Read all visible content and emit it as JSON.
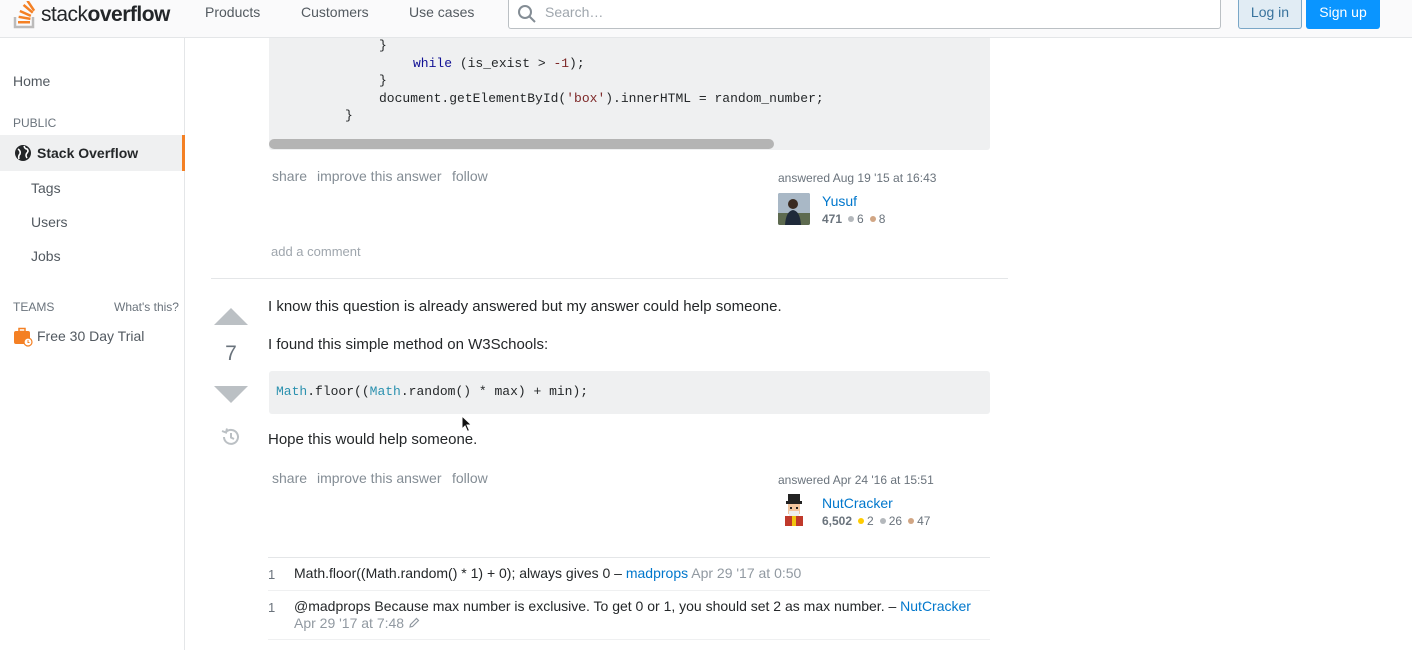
{
  "header": {
    "logo_prefix": "stack",
    "logo_suffix": "overflow",
    "nav": [
      "Products",
      "Customers",
      "Use cases"
    ],
    "search_placeholder": "Search…",
    "login_label": "Log in",
    "signup_label": "Sign up"
  },
  "sidebar": {
    "home": "Home",
    "public_label": "PUBLIC",
    "active_label": "Stack Overflow",
    "items": [
      "Tags",
      "Users",
      "Jobs"
    ],
    "teams_label": "TEAMS",
    "whats_this": "What's this?",
    "trial": "Free 30 Day Trial"
  },
  "answer1": {
    "code_lines": [
      {
        "indent": 4,
        "parts": [
          [
            "}",
            ""
          ]
        ]
      },
      {
        "indent": 4,
        "parts": [
          [
            "while",
            "kw"
          ],
          [
            " (is_exist > ",
            ""
          ],
          [
            "-1",
            "num"
          ],
          [
            ");",
            ""
          ]
        ]
      },
      {
        "indent": 3,
        "parts": [
          [
            "}",
            ""
          ]
        ]
      },
      {
        "indent": 3,
        "parts": [
          [
            "document.getElementById(",
            ""
          ],
          [
            "'box'",
            "str"
          ],
          [
            ").innerHTML = random_number;",
            ""
          ]
        ]
      },
      {
        "indent": 2,
        "parts": [
          [
            "}",
            ""
          ]
        ]
      }
    ],
    "actions": [
      "share",
      "improve this answer",
      "follow"
    ],
    "answered": "answered Aug 19 '15 at 16:43",
    "user": "Yusuf",
    "rep": "471",
    "silver": "6",
    "bronze": "8",
    "add_comment": "add a comment"
  },
  "answer2": {
    "score": "7",
    "p1": "I know this question is already answered but my answer could help someone.",
    "p2": "I found this simple method on W3Schools:",
    "code_parts": [
      [
        "Math",
        "typ"
      ],
      [
        ".floor((",
        ""
      ],
      [
        "Math",
        "typ"
      ],
      [
        ".random() * max) + min);",
        ""
      ]
    ],
    "p3": "Hope this would help someone.",
    "actions": [
      "share",
      "improve this answer",
      "follow"
    ],
    "answered": "answered Apr 24 '16 at 15:51",
    "user": "NutCracker",
    "rep": "6,502",
    "gold": "2",
    "silver": "26",
    "bronze": "47"
  },
  "comments": [
    {
      "score": "1",
      "text": "Math.floor((Math.random() * 1) + 0); always gives 0 – ",
      "user": "madprops",
      "date": "Apr 29 '17 at 0:50"
    },
    {
      "score": "1",
      "text": "@madprops Because max number is exclusive. To get 0 or 1, you should set 2 as max number. – ",
      "user": "NutCracker",
      "date": "Apr 29 '17 at 7:48"
    }
  ],
  "colors": {
    "accent": "#f48024",
    "link": "#0077cc",
    "gold": "#ffcc01",
    "silver": "#b4b8bc",
    "bronze": "#d1a684"
  }
}
